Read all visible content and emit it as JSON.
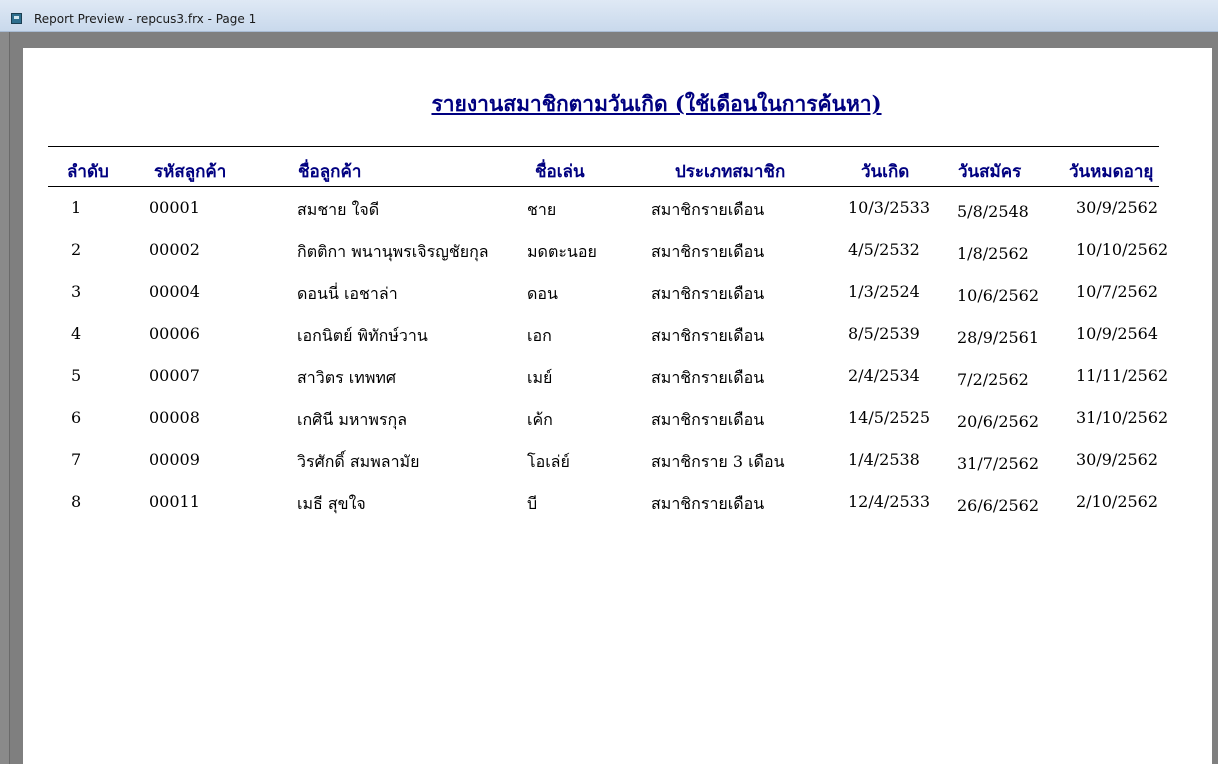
{
  "window": {
    "title": "Report Preview - repcus3.frx - Page 1",
    "icon": "report-preview-icon"
  },
  "report": {
    "title": "รายงานสมาชิกตามวันเกิด (ใช้เดือนในการค้นหา)",
    "columns": [
      "ลำดับ",
      "รหัสลูกค้า",
      "ชื่อลูกค้า",
      "ชื่อเล่น",
      "ประเภทสมาชิก",
      "วันเกิด",
      "วันสมัคร",
      "วันหมดอายุ"
    ],
    "rows": [
      [
        "1",
        "00001",
        "สมชาย ใจดี",
        "ชาย",
        "สมาชิกรายเดือน",
        "10/3/2533",
        "5/8/2548",
        "30/9/2562"
      ],
      [
        "2",
        "00002",
        "กิตติกา พนานุพรเจิรญชัยกุล",
        "มดตะนอย",
        "สมาชิกรายเดือน",
        "4/5/2532",
        "1/8/2562",
        "10/10/2562"
      ],
      [
        "3",
        "00004",
        "ดอนนี่ เอชาล่า",
        "ดอน",
        "สมาชิกรายเดือน",
        "1/3/2524",
        "10/6/2562",
        "10/7/2562"
      ],
      [
        "4",
        "00006",
        "เอกนิตย์ พิทักษ์วาน",
        "เอก",
        "สมาชิกรายเดือน",
        "8/5/2539",
        "28/9/2561",
        "10/9/2564"
      ],
      [
        "5",
        "00007",
        "สาวิตร เทพทศ",
        "เมย์",
        "สมาชิกรายเดือน",
        "2/4/2534",
        "7/2/2562",
        "11/11/2562"
      ],
      [
        "6",
        "00008",
        "เกศินี มหาพรกุล",
        "เค้ก",
        "สมาชิกรายเดือน",
        "14/5/2525",
        "20/6/2562",
        "31/10/2562"
      ],
      [
        "7",
        "00009",
        "วิรศักดิ์ สมพลามัย",
        "โอเล่ย์",
        "สมาชิกราย 3 เดือน",
        "1/4/2538",
        "31/7/2562",
        "30/9/2562"
      ],
      [
        "8",
        "00011",
        "เมธี สุขใจ",
        "บี",
        "สมาชิกรายเดือน",
        "12/4/2533",
        "26/6/2562",
        "2/10/2562"
      ]
    ]
  }
}
